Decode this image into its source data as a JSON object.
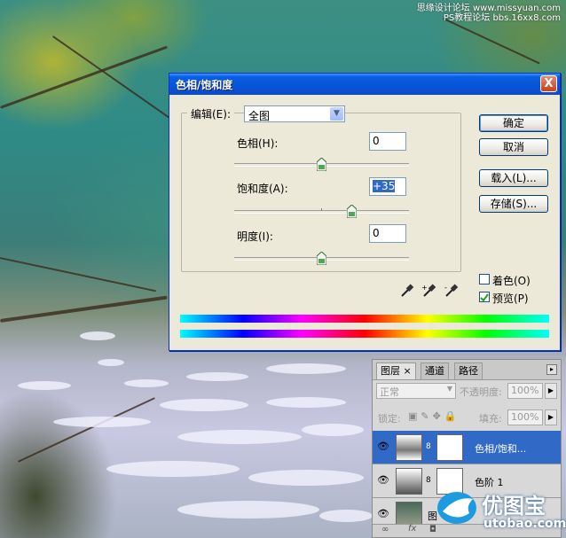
{
  "watermark_top": {
    "line1": "思缘设计论坛 www.missyuan.com",
    "line2": "PS教程论坛 bbs.16xx8.com"
  },
  "dialog": {
    "title": "色相/饱和度",
    "close_label": "X",
    "edit_label": "编辑(E):",
    "edit_value": "全图",
    "hue": {
      "label": "色相(H):",
      "value": "0",
      "level": 0
    },
    "saturation": {
      "label": "饱和度(A):",
      "value": "+35",
      "level": 35
    },
    "lightness": {
      "label": "明度(I):",
      "value": "0",
      "level": 0
    },
    "slider_range": [
      -100,
      100
    ],
    "buttons": {
      "ok": "确定",
      "cancel": "取消",
      "load": "载入(L)...",
      "save": "存储(S)..."
    },
    "colorize": {
      "label": "着色(O)",
      "checked": false
    },
    "preview": {
      "label": "预览(P)",
      "checked": true
    },
    "eyedroppers": [
      "eyedropper-icon",
      "eyedropper-plus-icon",
      "eyedropper-minus-icon"
    ]
  },
  "layers_panel": {
    "tabs": [
      "图层",
      "通道",
      "路径"
    ],
    "tab_close": "×",
    "blend_mode": "正常",
    "opacity_label": "不透明度:",
    "opacity_value": "100%",
    "lock_label": "锁定:",
    "fill_label": "填充:",
    "fill_value": "100%",
    "layers": [
      {
        "name": "色相/饱和...",
        "active": true,
        "visible": true
      },
      {
        "name": "色阶 1",
        "active": false,
        "visible": true
      },
      {
        "name": "图",
        "active": false,
        "visible": true
      }
    ]
  },
  "logo": {
    "name": "优图宝",
    "site": "utobao.com"
  },
  "colors": {
    "title_bar": "#0854d6",
    "dialog_bg": "#ece9d8",
    "active_layer": "#3169c6"
  }
}
